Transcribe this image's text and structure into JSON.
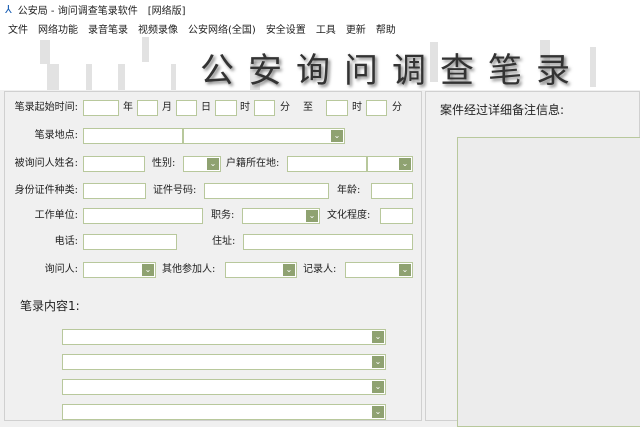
{
  "window": {
    "title": "公安局 - 询问调查笔录软件",
    "edition": "[网络版]"
  },
  "menu": [
    "文件",
    "网络功能",
    "录音笔录",
    "视频录像",
    "公安网络(全国)",
    "安全设置",
    "工具",
    "更新",
    "帮助"
  ],
  "banner_title": "公安询问调查笔录",
  "form": {
    "start_time_label": "笔录起始时间:",
    "year": "年",
    "month": "月",
    "day": "日",
    "hour": "时",
    "minute": "分",
    "to": "至",
    "hour2": "时",
    "minute2": "分",
    "location_label": "笔录地点:",
    "name_label": "被询问人姓名:",
    "gender_label": "性别:",
    "household_label": "户籍所在地:",
    "id_type_label": "身份证件种类:",
    "id_number_label": "证件号码:",
    "age_label": "年龄:",
    "work_label": "工作单位:",
    "position_label": "职务:",
    "education_label": "文化程度:",
    "phone_label": "电话:",
    "address_label": "住址:",
    "interviewer_label": "询问人:",
    "others_label": "其他参加人:",
    "recorder_label": "记录人:",
    "content_label": "笔录内容1:"
  },
  "notes": {
    "label": "案件经过详细备注信息:"
  },
  "colors": {
    "border": "#b8c89c",
    "dropdown": "#8fa271"
  }
}
